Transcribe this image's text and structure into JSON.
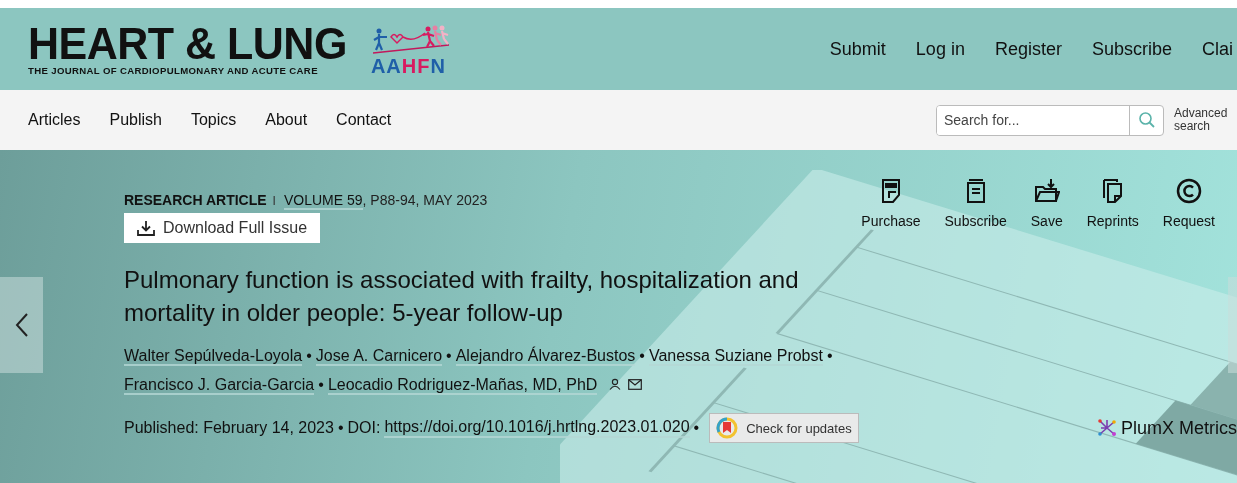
{
  "header": {
    "logo_title": "HEART & LUNG",
    "logo_subtitle": "THE JOURNAL OF CARDIOPULMONARY AND ACUTE CARE",
    "partner_a": "AA",
    "partner_b": "HF",
    "partner_c": "N",
    "links": [
      "Submit",
      "Log in",
      "Register",
      "Subscribe",
      "Clai"
    ]
  },
  "nav": {
    "items": [
      "Articles",
      "Publish",
      "Topics",
      "About",
      "Contact"
    ],
    "search": {
      "placeholder": "Search for..."
    },
    "advanced_search": "Advanced search"
  },
  "article": {
    "type": "RESEARCH ARTICLE",
    "type_separator": "I",
    "volume_link": "VOLUME 59",
    "volume_rest": ", P88-94, MAY 2023",
    "download_button": "Download Full Issue",
    "title": "Pulmonary function is associated with frailty, hospitalization and mortality in older people: 5-year follow-up",
    "separator": "•",
    "authors": [
      {
        "name": "Walter Sepúlveda-Loyola"
      },
      {
        "name": "Jose A. Carnicero"
      },
      {
        "name": "Alejandro Álvarez-Bustos"
      },
      {
        "name": "Vanessa Suziane Probst"
      },
      {
        "name": "Francisco J. Garcia-Garcia"
      },
      {
        "name": "Leocadio Rodriguez-Mañas, MD, PhD"
      }
    ],
    "published": "Published: February 14, 2023",
    "doi_label": "DOI:",
    "doi": "https://doi.org/10.1016/j.hrtlng.2023.01.020",
    "check_updates": "Check for updates",
    "plumx": "PlumX Metrics"
  },
  "actions": [
    {
      "label": "Purchase",
      "kind": "pdf"
    },
    {
      "label": "Subscribe",
      "kind": "journal"
    },
    {
      "label": "Save",
      "kind": "folder"
    },
    {
      "label": "Reprints",
      "kind": "pages"
    },
    {
      "label": "Request",
      "kind": "copyright"
    }
  ]
}
